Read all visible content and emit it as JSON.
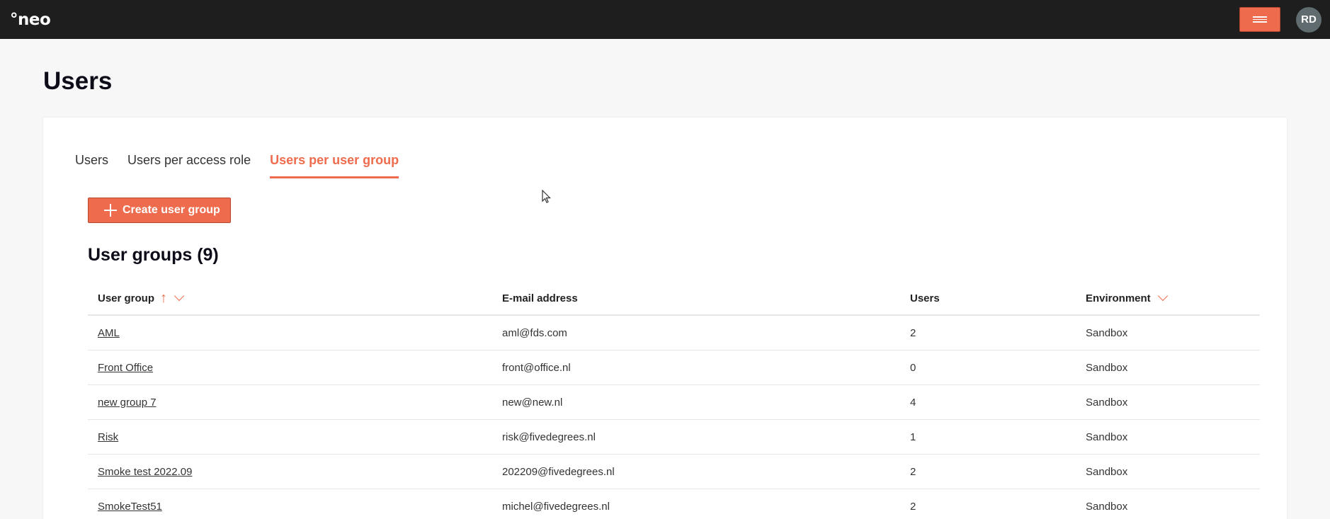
{
  "header": {
    "logo": "°neo",
    "avatar_initials": "RD"
  },
  "page": {
    "title": "Users"
  },
  "tabs": [
    {
      "label": "Users",
      "active": false
    },
    {
      "label": "Users per access role",
      "active": false
    },
    {
      "label": "Users per user group",
      "active": true
    }
  ],
  "actions": {
    "create_label": "Create user group"
  },
  "section": {
    "title": "User groups (9)"
  },
  "table": {
    "columns": [
      "User group",
      "E-mail address",
      "Users",
      "Environment"
    ],
    "rows": [
      {
        "group": "AML",
        "email": "aml@fds.com",
        "users": "2",
        "environment": "Sandbox"
      },
      {
        "group": "Front Office",
        "email": "front@office.nl",
        "users": "0",
        "environment": "Sandbox"
      },
      {
        "group": "new group 7",
        "email": "new@new.nl",
        "users": "4",
        "environment": "Sandbox"
      },
      {
        "group": "Risk",
        "email": "risk@fivedegrees.nl",
        "users": "1",
        "environment": "Sandbox"
      },
      {
        "group": "Smoke test 2022.09",
        "email": "202209@fivedegrees.nl",
        "users": "2",
        "environment": "Sandbox"
      },
      {
        "group": "SmokeTest51",
        "email": "michel@fivedegrees.nl",
        "users": "2",
        "environment": "Sandbox"
      }
    ]
  },
  "colors": {
    "accent": "#ee6c4d",
    "topbar": "#1e1e1e",
    "avatar": "#5f6b6e"
  }
}
